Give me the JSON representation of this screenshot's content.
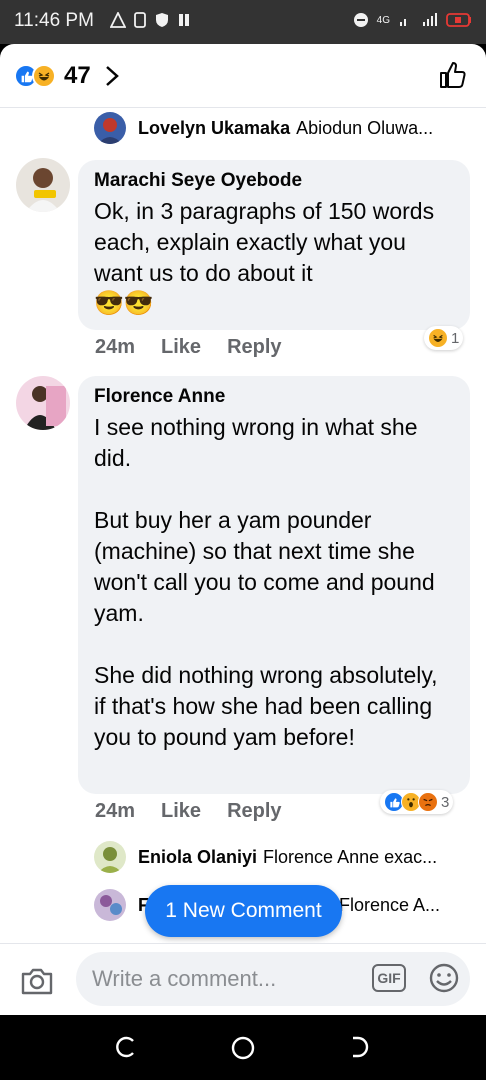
{
  "status_bar": {
    "time": "11:46 PM",
    "network_label": "4G",
    "icons": [
      "warning-icon",
      "sim-icon",
      "shield-icon",
      "pause-icon",
      "dnd-icon",
      "wifi-icon",
      "signal-icon",
      "battery-low-icon"
    ]
  },
  "header": {
    "reaction_icons": [
      "like-reaction-icon",
      "haha-reaction-icon"
    ],
    "reaction_count": "47",
    "like_icon": "thumbs-up-outline-icon"
  },
  "reply_preview_top": {
    "name": "Lovelyn Ukamaka",
    "text": "Abiodun Oluwa..."
  },
  "comments": [
    {
      "name": "Marachi Seye Oyebode",
      "text": "Ok, in 3 paragraphs of 150 words each, explain exactly what you want us to do about it",
      "emoji": "😎😎",
      "age": "24m",
      "like_label": "Like",
      "reply_label": "Reply",
      "reactions": [
        "haha-reaction-icon"
      ],
      "reaction_count": "1"
    },
    {
      "name": "Florence Anne",
      "text": "I see nothing wrong in what she did.\n\nBut buy her a yam pounder (machine) so that next time she won't call you to come and pound yam.\n\nShe did nothing wrong absolutely, if that's how she had been calling you to pound yam before!",
      "age": "24m",
      "like_label": "Like",
      "reply_label": "Reply",
      "reactions": [
        "like-reaction-icon",
        "wow-reaction-icon",
        "angry-reaction-icon"
      ],
      "reaction_count": "3"
    }
  ],
  "replies": [
    {
      "name": "Eniola Olaniyi",
      "text": "Florence Anne exac..."
    },
    {
      "name": "F",
      "text": "Florence A..."
    }
  ],
  "new_comment_pill": "1 New Comment",
  "composer": {
    "placeholder": "Write a comment...",
    "gif_label": "GIF"
  },
  "colors": {
    "accent": "#1877f2",
    "bubble_bg": "#f0f2f5",
    "meta_text": "#65676b",
    "status_bar_bg": "#333333"
  }
}
